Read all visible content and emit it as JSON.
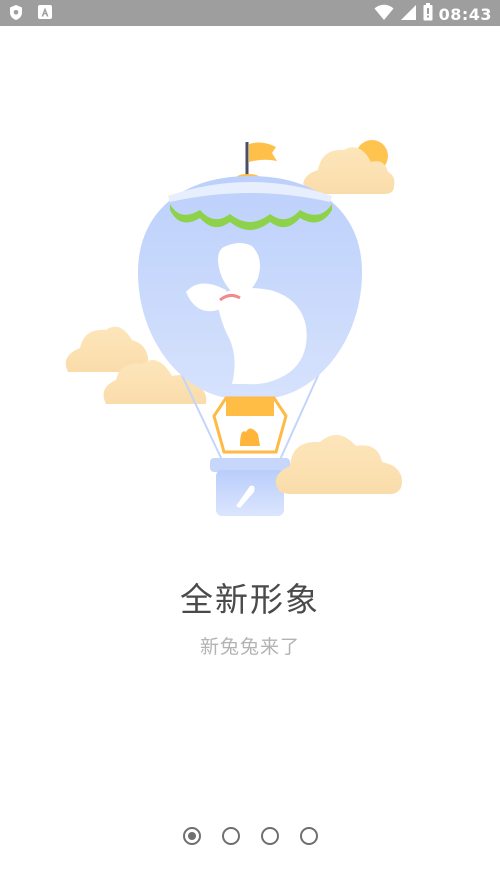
{
  "status_bar": {
    "time": "08:43",
    "left_icons": [
      "shield-icon",
      "app-notification-icon"
    ],
    "right_icons": [
      "wifi-icon",
      "signal-icon",
      "battery-icon"
    ]
  },
  "onboarding": {
    "title": "全新形象",
    "subtitle": "新兔兔来了",
    "pages": [
      {
        "active": true
      },
      {
        "active": false
      },
      {
        "active": false
      },
      {
        "active": false
      }
    ]
  },
  "colors": {
    "status_bar_bg": "#9e9e9e",
    "balloon": "#c3d4fb",
    "cloud": "#fbe2b4",
    "accent_orange": "#ffba3c",
    "scallop_green": "#8fd34a"
  }
}
